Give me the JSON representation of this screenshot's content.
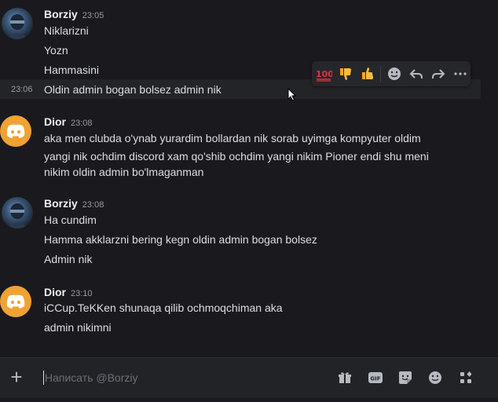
{
  "messages": [
    {
      "author": "Borziy",
      "time": "23:05",
      "lines": [
        "Niklarizni",
        "Yozn",
        "Hammasini"
      ]
    },
    {
      "hover_time": "23:06",
      "line": "Oldin admin bogan bolsez admin nik"
    },
    {
      "author": "Dior",
      "time": "23:08",
      "lines": [
        "aka men clubda o'ynab yurardim bollardan nik sorab uyimga kompyuter oldim",
        "yangi nik ochdim discord xam qo'shib ochdim yangi nikim Pioner endi shu meni",
        "nikim oldin admin bo'lmaganman"
      ]
    },
    {
      "author": "Borziy",
      "time": "23:08",
      "lines": [
        "Ha cundim",
        "Hamma akklarzni bering kegn oldin admin bogan bolsez",
        "Admin nik"
      ]
    },
    {
      "author": "Dior",
      "time": "23:10",
      "lines": [
        "iCCup.TeKKen shunaqa qilib ochmoqchiman aka",
        "admin nikimni"
      ]
    }
  ],
  "toolbar": {
    "reactions": [
      "100",
      "thumbs-down",
      "thumbs-up"
    ],
    "actions": [
      "add-reaction",
      "reply",
      "forward",
      "more"
    ]
  },
  "composer": {
    "placeholder": "Написать @Borziy",
    "gif_label": "GIF"
  },
  "colors": {
    "background": "#1a1a1e",
    "dior_avatar": "#f0a232",
    "username": "#f2f3f5",
    "timestamp": "#949ba4"
  }
}
